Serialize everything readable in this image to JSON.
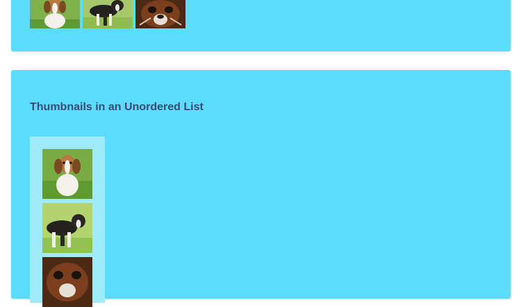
{
  "sections": {
    "unordered_list_title": "Thumbnails in an Unordered List"
  },
  "thumbnails": [
    {
      "subject": "beagle-puppy"
    },
    {
      "subject": "black-and-white-puppy"
    },
    {
      "subject": "beagle-face"
    }
  ],
  "colors": {
    "panel_bg": "#5bdcfc",
    "list_bg": "#9eebfb",
    "title_text": "#3b4a75"
  }
}
